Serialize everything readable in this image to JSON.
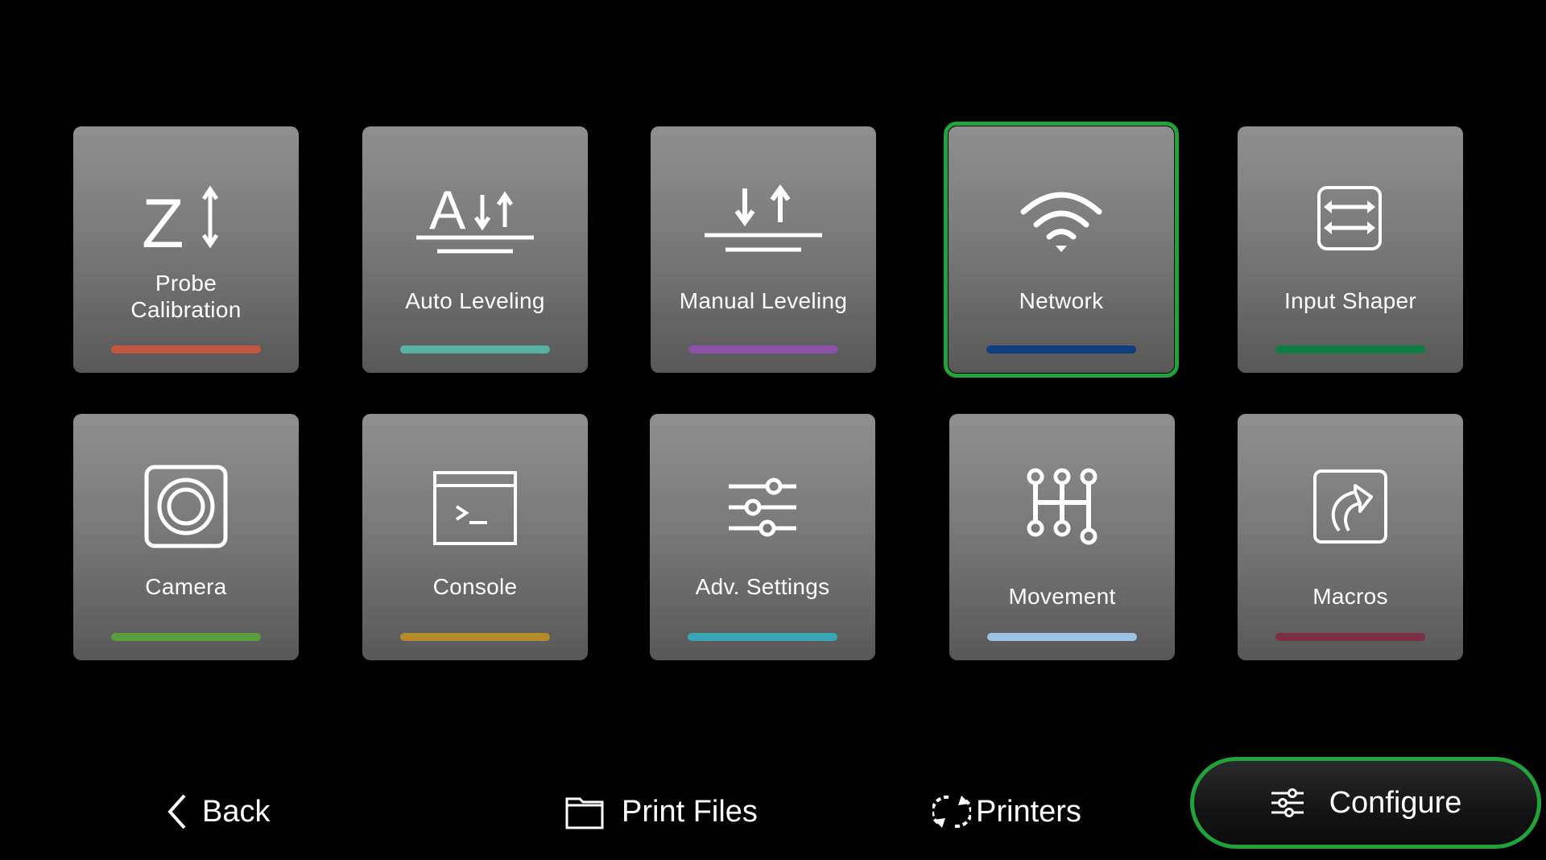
{
  "tiles": [
    {
      "label": "Probe Calibration",
      "icon": "probe-calibration-icon",
      "bar_color": "#c4553f",
      "selected": false
    },
    {
      "label": "Auto Leveling",
      "icon": "auto-leveling-icon",
      "bar_color": "#56b3a3",
      "selected": false
    },
    {
      "label": "Manual Leveling",
      "icon": "manual-leveling-icon",
      "bar_color": "#8c51a8",
      "selected": false
    },
    {
      "label": "Network",
      "icon": "wifi-icon",
      "bar_color": "#0d3f7f",
      "selected": true
    },
    {
      "label": "Input Shaper",
      "icon": "input-shaper-icon",
      "bar_color": "#0f7e45",
      "selected": false
    },
    {
      "label": "Camera",
      "icon": "camera-icon",
      "bar_color": "#5a9e3e",
      "selected": false
    },
    {
      "label": "Console",
      "icon": "console-icon",
      "bar_color": "#b48a2a",
      "selected": false
    },
    {
      "label": "Adv. Settings",
      "icon": "sliders-icon",
      "bar_color": "#3aa6b5",
      "selected": false
    },
    {
      "label": "Movement",
      "icon": "movement-icon",
      "bar_color": "#9ec2e4",
      "selected": false
    },
    {
      "label": "Macros",
      "icon": "macros-icon",
      "bar_color": "#7a2f45",
      "selected": false
    }
  ],
  "nav": {
    "back_label": "Back",
    "print_files_label": "Print Files",
    "printers_label": "Printers",
    "configure_label": "Configure",
    "active": "Configure",
    "accent_color": "#1fa33a"
  }
}
